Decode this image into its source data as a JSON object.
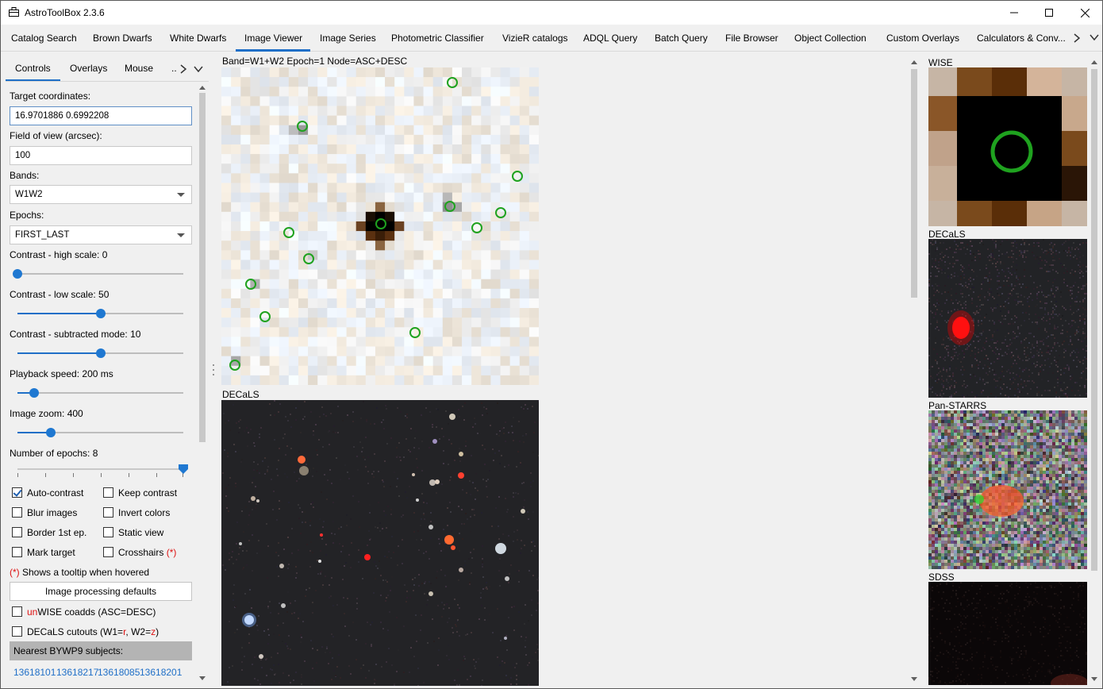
{
  "window": {
    "title": "AstroToolBox 2.3.6",
    "minimize": "—",
    "maximize": "☐",
    "close": "✕"
  },
  "tabs": [
    {
      "label": "Catalog Search"
    },
    {
      "label": "Brown Dwarfs"
    },
    {
      "label": "White Dwarfs"
    },
    {
      "label": "Image Viewer",
      "active": true
    },
    {
      "label": "Image Series"
    },
    {
      "label": "Photometric Classifier"
    },
    {
      "label": "VizieR catalogs"
    },
    {
      "label": "ADQL Query"
    },
    {
      "label": "Batch Query"
    },
    {
      "label": "File Browser"
    },
    {
      "label": "Object Collection"
    },
    {
      "label": "Custom Overlays"
    },
    {
      "label": "Calculators & Conv..."
    }
  ],
  "subtabs": {
    "controls": "Controls",
    "overlays": "Overlays",
    "mouse": "Mouse",
    "more": ".."
  },
  "controls": {
    "target_label": "Target coordinates:",
    "target_value": "16.9701886 0.6992208",
    "fov_label": "Field of view (arcsec):",
    "fov_value": "100",
    "bands_label": "Bands:",
    "bands_value": "W1W2",
    "epochs_label": "Epochs:",
    "epochs_value": "FIRST_LAST",
    "sliders": [
      {
        "label": "Contrast - high scale: 0",
        "fraction": 0.0
      },
      {
        "label": "Contrast - low scale: 50",
        "fraction": 0.5
      },
      {
        "label": "Contrast - subtracted mode: 10",
        "fraction": 0.5
      },
      {
        "label": "Playback speed: 200 ms",
        "fraction": 0.1
      },
      {
        "label": "Image zoom: 400",
        "fraction": 0.2
      },
      {
        "label": "Number of epochs: 8",
        "fraction": 1.0
      }
    ],
    "checkboxes": {
      "auto_contrast": {
        "label": "Auto-contrast",
        "checked": true
      },
      "keep_contrast": {
        "label": "Keep contrast",
        "checked": false
      },
      "blur_images": {
        "label": "Blur images",
        "checked": false
      },
      "invert_colors": {
        "label": "Invert colors",
        "checked": false
      },
      "border_first": {
        "label": "Border 1st ep.",
        "checked": false
      },
      "static_view": {
        "label": "Static view",
        "checked": false
      },
      "mark_target": {
        "label": "Mark target",
        "checked": false
      },
      "crosshairs": {
        "label": "Crosshairs",
        "checked": false,
        "marker": "(*)"
      }
    },
    "tooltip_note_marker": "(*)",
    "tooltip_note": " Shows a tooltip when hovered",
    "defaults_button": "Image processing defaults",
    "unwise": {
      "prefix": "un",
      "label": "WISE coadds (ASC=DESC)",
      "checked": false
    },
    "decals": {
      "label_a": "DECaLS cutouts (W1=",
      "r": "r",
      "label_b": ", W2=",
      "z": "z",
      "label_c": ")",
      "checked": false
    },
    "nearest_header": "Nearest BYWP9 subjects:",
    "subjects": [
      "13618101",
      "13618217",
      "13618085",
      "13618201"
    ]
  },
  "viewer": {
    "main_info": "Band=W1+W2   Epoch=1   Node=ASC+DESC",
    "decals_label": "DECaLS"
  },
  "right_panel": {
    "wise": "WISE",
    "decals": "DECaLS",
    "panstarrs": "Pan-STARRS",
    "sdss": "SDSS"
  },
  "colors": {
    "accent": "#1f6fc7",
    "overlay_circle": "#1fa21f",
    "red_text": "#dd1111"
  }
}
